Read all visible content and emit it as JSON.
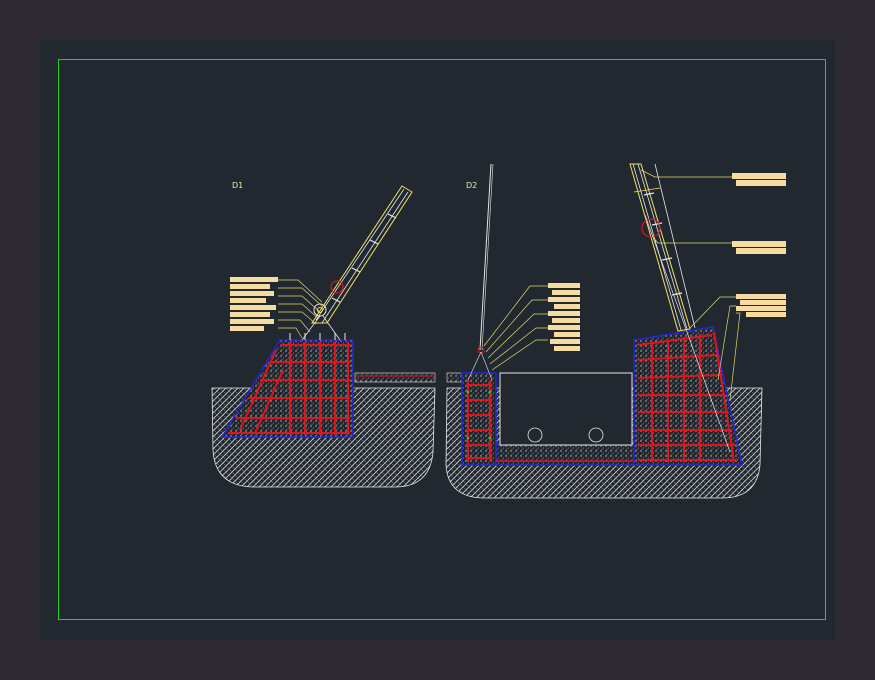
{
  "detail_labels": {
    "d1": "D1",
    "d2": "D2"
  },
  "colors": {
    "background": "#212830",
    "outer_background": "#2d2a33",
    "frame": "#1fd31f",
    "rebar": "#e0141a",
    "outline": "#2226d8",
    "leader": "#e6d66a",
    "tag": "#f6dca0",
    "soil": "#d9d9d9",
    "concrete_dots": "#bfbfbf",
    "cad_white": "#e6e6e6"
  }
}
